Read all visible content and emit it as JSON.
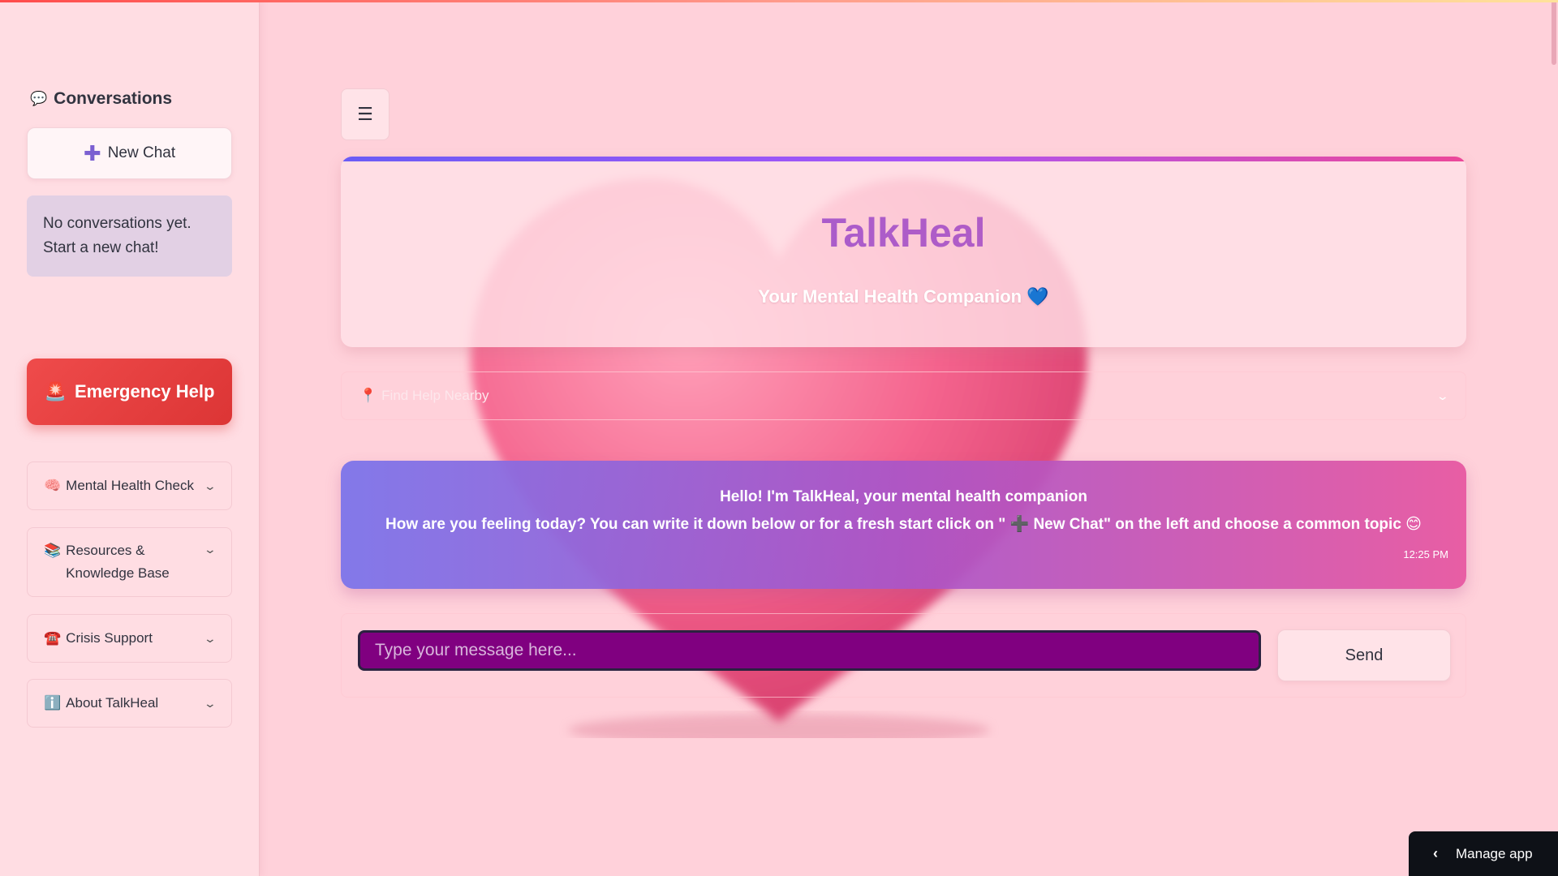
{
  "sidebar": {
    "conversations_icon": "💬",
    "conversations_title": "Conversations",
    "new_chat_icon": "➕",
    "new_chat_label": "New Chat",
    "empty_message": "No conversations yet. Start a new chat!",
    "emergency_icon": "🚨",
    "emergency_label": "Emergency Help",
    "expanders": [
      {
        "icon": "🧠",
        "label": "Mental Health Check"
      },
      {
        "icon": "📚",
        "label": "Resources & Knowledge Base"
      },
      {
        "icon": "☎️",
        "label": "Crisis Support"
      },
      {
        "icon": "ℹ️",
        "label": "About TalkHeal"
      }
    ]
  },
  "main": {
    "menu_icon": "☰",
    "title": "TalkHeal",
    "subtitle": "Your Mental Health Companion 💙",
    "find_help_icon": "📍",
    "find_help_label": "Find Help Nearby",
    "message": {
      "line1": "Hello! I'm TalkHeal, your mental health companion",
      "line2": "How are you feeling today? You can write it down below or for a fresh start click on \" ➕ New Chat\" on the left and choose a common topic 😊",
      "time": "12:25 PM"
    },
    "input_placeholder": "Type your message here...",
    "send_label": "Send"
  },
  "footer": {
    "manage_app_icon": "‹",
    "manage_app_label": "Manage app"
  },
  "colors": {
    "background": "#ffd1da",
    "accent_purple": "#9a57d8",
    "emergency_red": "#dc3535",
    "input_bg": "#800080"
  }
}
